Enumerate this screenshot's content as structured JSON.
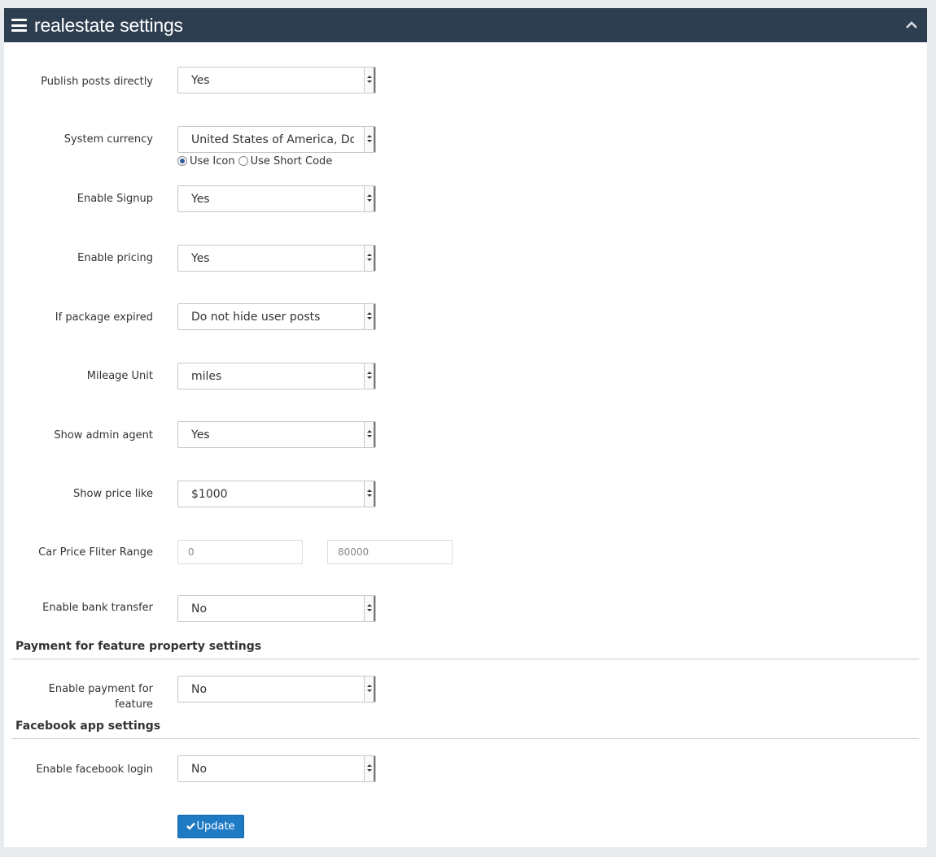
{
  "header": {
    "title": "realestate settings",
    "menu_icon": "hamburger-icon",
    "collapse_icon": "chevron-up-icon"
  },
  "settings": [
    {
      "label": "Publish posts directly",
      "value": "Yes"
    },
    {
      "label": "System currency",
      "value": "United States of America, Dollars"
    },
    {
      "label": "Enable Signup",
      "value": "Yes"
    },
    {
      "label": "Enable pricing",
      "value": "Yes"
    },
    {
      "label": "If package expired",
      "value": "Do not hide user posts"
    },
    {
      "label": "Mileage Unit",
      "value": "miles"
    },
    {
      "label": "Show admin agent",
      "value": "Yes"
    },
    {
      "label": "Show price like",
      "value": "$1000"
    },
    {
      "label": "Enable bank transfer",
      "value": "No"
    }
  ],
  "currency_display": {
    "options": [
      "Use Icon",
      "Use Short Code"
    ],
    "selected": "Use Icon"
  },
  "price_range": {
    "label": "Car Price Fliter Range",
    "min": "0",
    "max": "80000"
  },
  "payment_section": {
    "title": "Payment for feature property settings",
    "label_line1": "Enable payment for",
    "label_line2": "feature",
    "value": "No"
  },
  "facebook_section": {
    "title": "Facebook app settings",
    "label": "Enable facebook login",
    "value": "No"
  },
  "update_button": {
    "label": "Update",
    "icon": "check-icon",
    "color": "#1f7ac4"
  },
  "colors": {
    "header_bg": "#2d3e50",
    "page_bg": "#e8ebee"
  }
}
